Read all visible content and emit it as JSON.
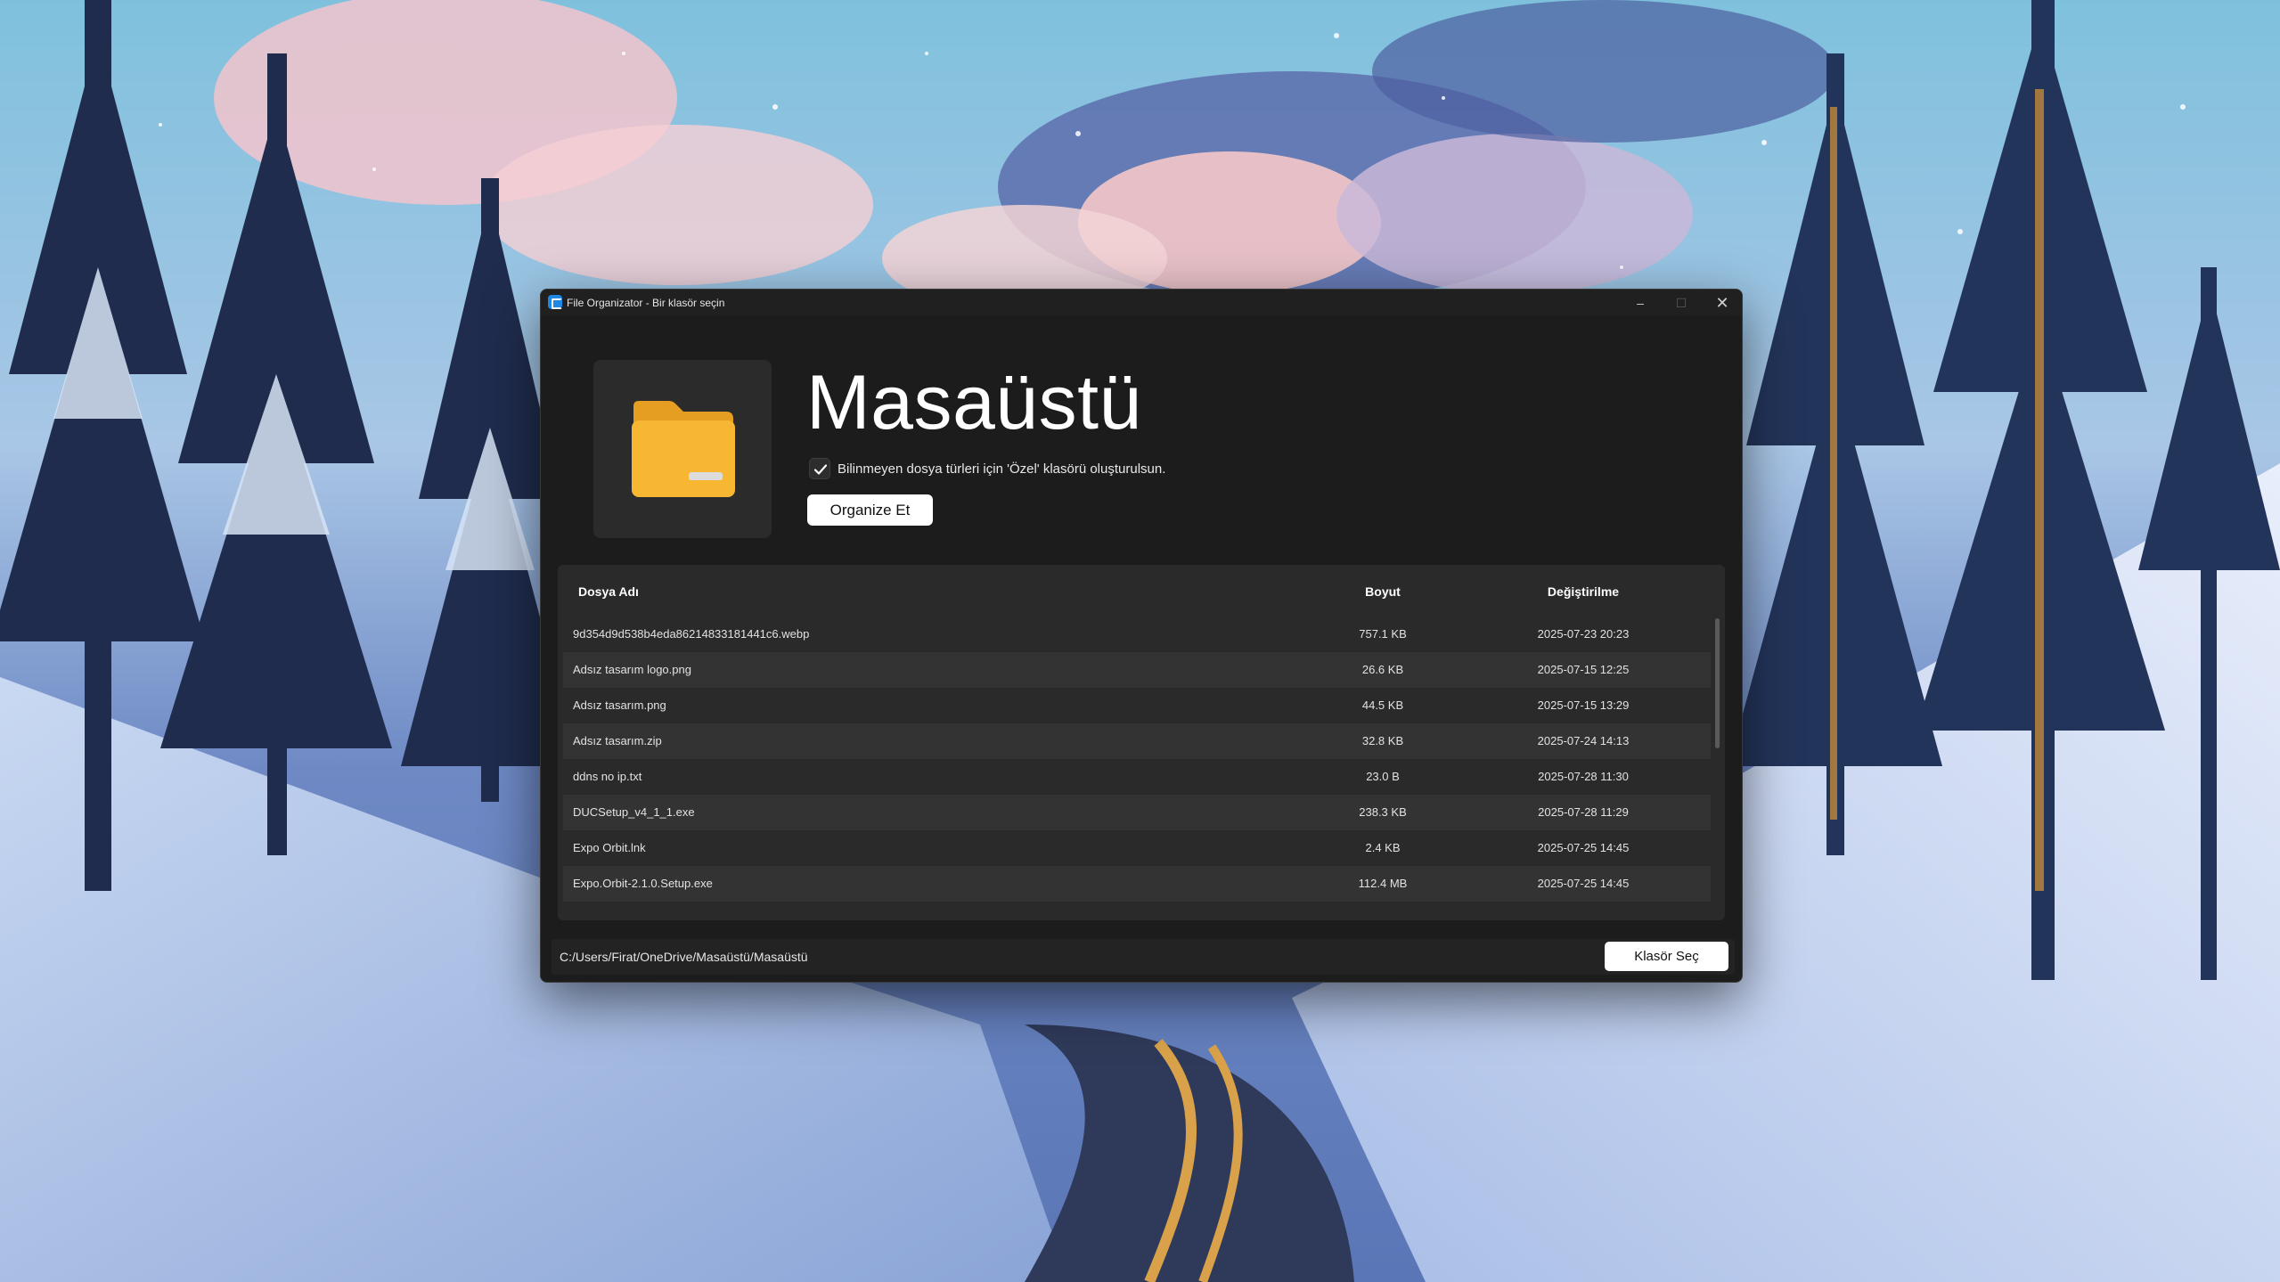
{
  "window": {
    "title": "File Organizator - Bir klasör seçin",
    "controls": {
      "minimize": "–",
      "maximize": "☐",
      "close": "✕"
    }
  },
  "header": {
    "folder_name": "Masaüstü",
    "checkbox_checked": true,
    "checkbox_label": "Bilinmeyen dosya türleri için 'Özel' klasörü oluşturulsun.",
    "organize_button": "Organize Et"
  },
  "table": {
    "columns": {
      "name": "Dosya Adı",
      "size": "Boyut",
      "modified": "Değiştirilme"
    },
    "rows": [
      {
        "name": "9d354d9d538b4eda86214833181441c6.webp",
        "size": "757.1 KB",
        "modified": "2025-07-23 20:23"
      },
      {
        "name": "Adsız tasarım logo.png",
        "size": "26.6 KB",
        "modified": "2025-07-15 12:25"
      },
      {
        "name": "Adsız tasarım.png",
        "size": "44.5 KB",
        "modified": "2025-07-15 13:29"
      },
      {
        "name": "Adsız tasarım.zip",
        "size": "32.8 KB",
        "modified": "2025-07-24 14:13"
      },
      {
        "name": "ddns no ip.txt",
        "size": "23.0 B",
        "modified": "2025-07-28 11:30"
      },
      {
        "name": "DUCSetup_v4_1_1.exe",
        "size": "238.3 KB",
        "modified": "2025-07-28 11:29"
      },
      {
        "name": "Expo Orbit.lnk",
        "size": "2.4 KB",
        "modified": "2025-07-25 14:45"
      },
      {
        "name": "Expo.Orbit-2.1.0.Setup.exe",
        "size": "112.4 MB",
        "modified": "2025-07-25 14:45"
      }
    ]
  },
  "footer": {
    "path": "C:/Users/Firat/OneDrive/Masaüstü/Masaüstü",
    "select_button": "Klasör Seç"
  },
  "colors": {
    "window_bg": "#1c1c1c",
    "panel_bg": "#2a2a2a",
    "row_alt": "#333333",
    "folder_yellow": "#f7b733",
    "button_bg": "#ffffff"
  },
  "icons": {
    "app": "app-icon",
    "folder": "folder-icon",
    "check": "checkmark-icon"
  }
}
